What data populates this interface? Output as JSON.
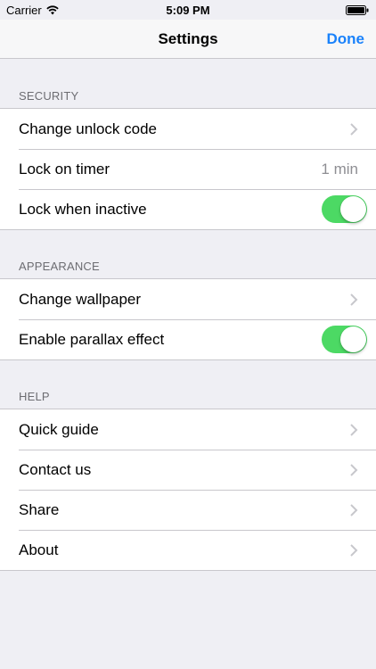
{
  "status_bar": {
    "carrier": "Carrier",
    "time": "5:09 PM"
  },
  "nav": {
    "title": "Settings",
    "done_label": "Done"
  },
  "sections": [
    {
      "header": "SECURITY",
      "rows": [
        {
          "label": "Change unlock code",
          "accessory": "chevron"
        },
        {
          "label": "Lock on timer",
          "value": "1 min"
        },
        {
          "label": "Lock when inactive",
          "toggle": true
        }
      ]
    },
    {
      "header": "APPEARANCE",
      "rows": [
        {
          "label": "Change wallpaper",
          "accessory": "chevron"
        },
        {
          "label": "Enable parallax effect",
          "toggle": true
        }
      ]
    },
    {
      "header": "HELP",
      "rows": [
        {
          "label": "Quick guide",
          "accessory": "chevron"
        },
        {
          "label": "Contact us",
          "accessory": "chevron"
        },
        {
          "label": "Share",
          "accessory": "chevron"
        },
        {
          "label": "About",
          "accessory": "chevron"
        }
      ]
    }
  ],
  "colors": {
    "accent": "#1a82fb",
    "toggle_on": "#4cd964",
    "background": "#efeff4"
  }
}
